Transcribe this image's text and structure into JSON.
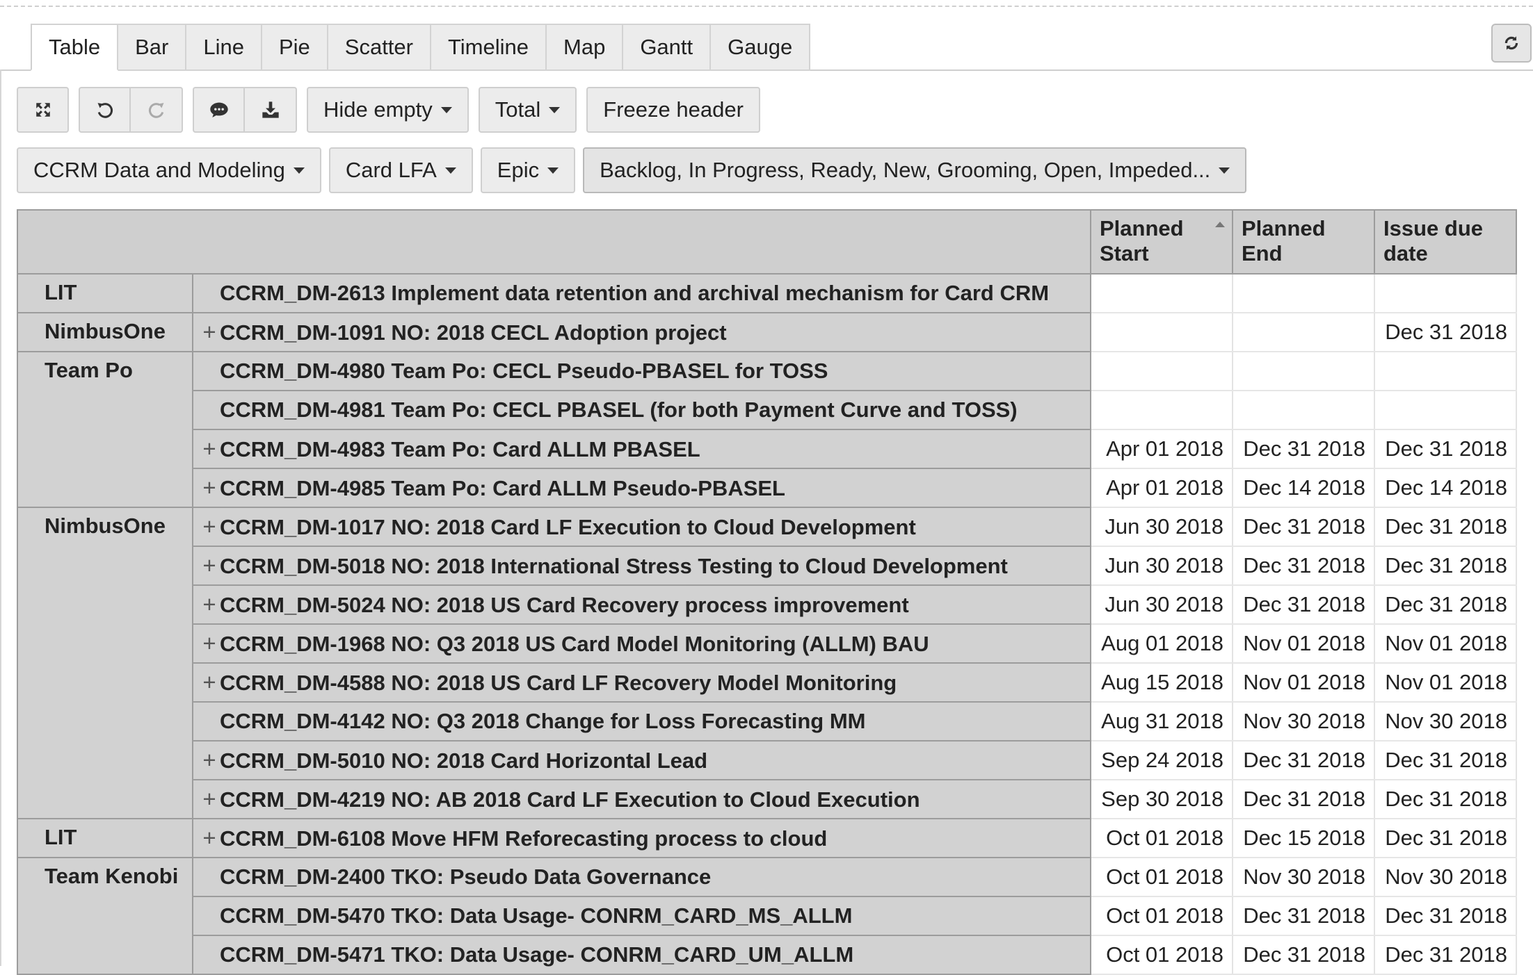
{
  "tabs": [
    "Table",
    "Bar",
    "Line",
    "Pie",
    "Scatter",
    "Timeline",
    "Map",
    "Gantt",
    "Gauge"
  ],
  "active_tab": "Table",
  "toolbar": {
    "fullscreen_icon": "expand-icon",
    "undo_icon": "undo-icon",
    "redo_icon": "redo-icon",
    "comment_icon": "comment-icon",
    "download_icon": "download-icon",
    "hide_empty": "Hide empty",
    "total": "Total",
    "freeze_header": "Freeze header",
    "refresh_icon": "refresh-icon"
  },
  "filters": {
    "project": "CCRM Data and Modeling",
    "dim1": "Card LFA",
    "dim2": "Epic",
    "status": "Backlog, In Progress, Ready, New, Grooming, Open, Impeded..."
  },
  "table": {
    "columns": [
      "Planned Start",
      "Planned End",
      "Issue due date"
    ],
    "groups": [
      {
        "label": "LIT",
        "rows": [
          {
            "expand": false,
            "issue": "CCRM_DM-2613 Implement data retention and archival mechanism for Card CRM",
            "start": "",
            "end": "",
            "due": ""
          }
        ]
      },
      {
        "label": "NimbusOne",
        "rows": [
          {
            "expand": true,
            "issue": "CCRM_DM-1091 NO: 2018 CECL Adoption project",
            "start": "",
            "end": "",
            "due": "Dec 31 2018"
          }
        ]
      },
      {
        "label": "Team Po",
        "rows": [
          {
            "expand": false,
            "issue": "CCRM_DM-4980 Team Po: CECL Pseudo-PBASEL for TOSS",
            "start": "",
            "end": "",
            "due": ""
          },
          {
            "expand": false,
            "issue": "CCRM_DM-4981 Team Po: CECL PBASEL (for both Payment Curve and TOSS)",
            "start": "",
            "end": "",
            "due": ""
          },
          {
            "expand": true,
            "issue": "CCRM_DM-4983 Team Po: Card ALLM PBASEL",
            "start": "Apr 01 2018",
            "end": "Dec 31 2018",
            "due": "Dec 31 2018"
          },
          {
            "expand": true,
            "issue": "CCRM_DM-4985 Team Po: Card ALLM Pseudo-PBASEL",
            "start": "Apr 01 2018",
            "end": "Dec 14 2018",
            "due": "Dec 14 2018"
          }
        ]
      },
      {
        "label": "NimbusOne",
        "rows": [
          {
            "expand": true,
            "issue": "CCRM_DM-1017 NO: 2018 Card LF Execution to Cloud Development",
            "start": "Jun 30 2018",
            "end": "Dec 31 2018",
            "due": "Dec 31 2018"
          },
          {
            "expand": true,
            "issue": "CCRM_DM-5018 NO: 2018 International Stress Testing to Cloud Development",
            "start": "Jun 30 2018",
            "end": "Dec 31 2018",
            "due": "Dec 31 2018"
          },
          {
            "expand": true,
            "issue": "CCRM_DM-5024 NO: 2018 US Card Recovery process improvement",
            "start": "Jun 30 2018",
            "end": "Dec 31 2018",
            "due": "Dec 31 2018"
          },
          {
            "expand": true,
            "issue": "CCRM_DM-1968 NO: Q3 2018 US Card Model Monitoring (ALLM) BAU",
            "start": "Aug 01 2018",
            "end": "Nov 01 2018",
            "due": "Nov 01 2018"
          },
          {
            "expand": true,
            "issue": "CCRM_DM-4588 NO: 2018 US Card LF Recovery Model Monitoring",
            "start": "Aug 15 2018",
            "end": "Nov 01 2018",
            "due": "Nov 01 2018"
          },
          {
            "expand": false,
            "issue": "CCRM_DM-4142 NO: Q3 2018 Change for Loss Forecasting MM",
            "start": "Aug 31 2018",
            "end": "Nov 30 2018",
            "due": "Nov 30 2018"
          },
          {
            "expand": true,
            "issue": "CCRM_DM-5010 NO: 2018 Card Horizontal Lead",
            "start": "Sep 24 2018",
            "end": "Dec 31 2018",
            "due": "Dec 31 2018"
          },
          {
            "expand": true,
            "issue": "CCRM_DM-4219 NO: AB 2018 Card LF Execution to Cloud Execution",
            "start": "Sep 30 2018",
            "end": "Dec 31 2018",
            "due": "Dec 31 2018"
          }
        ]
      },
      {
        "label": "LIT",
        "rows": [
          {
            "expand": true,
            "issue": "CCRM_DM-6108 Move HFM Reforecasting process to cloud",
            "start": "Oct 01 2018",
            "end": "Dec 15 2018",
            "due": "Dec 31 2018"
          }
        ]
      },
      {
        "label": "Team Kenobi",
        "rows": [
          {
            "expand": false,
            "issue": "CCRM_DM-2400 TKO: Pseudo Data Governance",
            "start": "Oct 01 2018",
            "end": "Nov 30 2018",
            "due": "Nov 30 2018"
          },
          {
            "expand": false,
            "issue": "CCRM_DM-5470 TKO: Data Usage- CONRM_CARD_MS_ALLM",
            "start": "Oct 01 2018",
            "end": "Dec 31 2018",
            "due": "Dec 31 2018"
          },
          {
            "expand": false,
            "issue": "CCRM_DM-5471 TKO: Data Usage- CONRM_CARD_UM_ALLM",
            "start": "Oct 01 2018",
            "end": "Dec 31 2018",
            "due": "Dec 31 2018"
          }
        ]
      }
    ]
  }
}
